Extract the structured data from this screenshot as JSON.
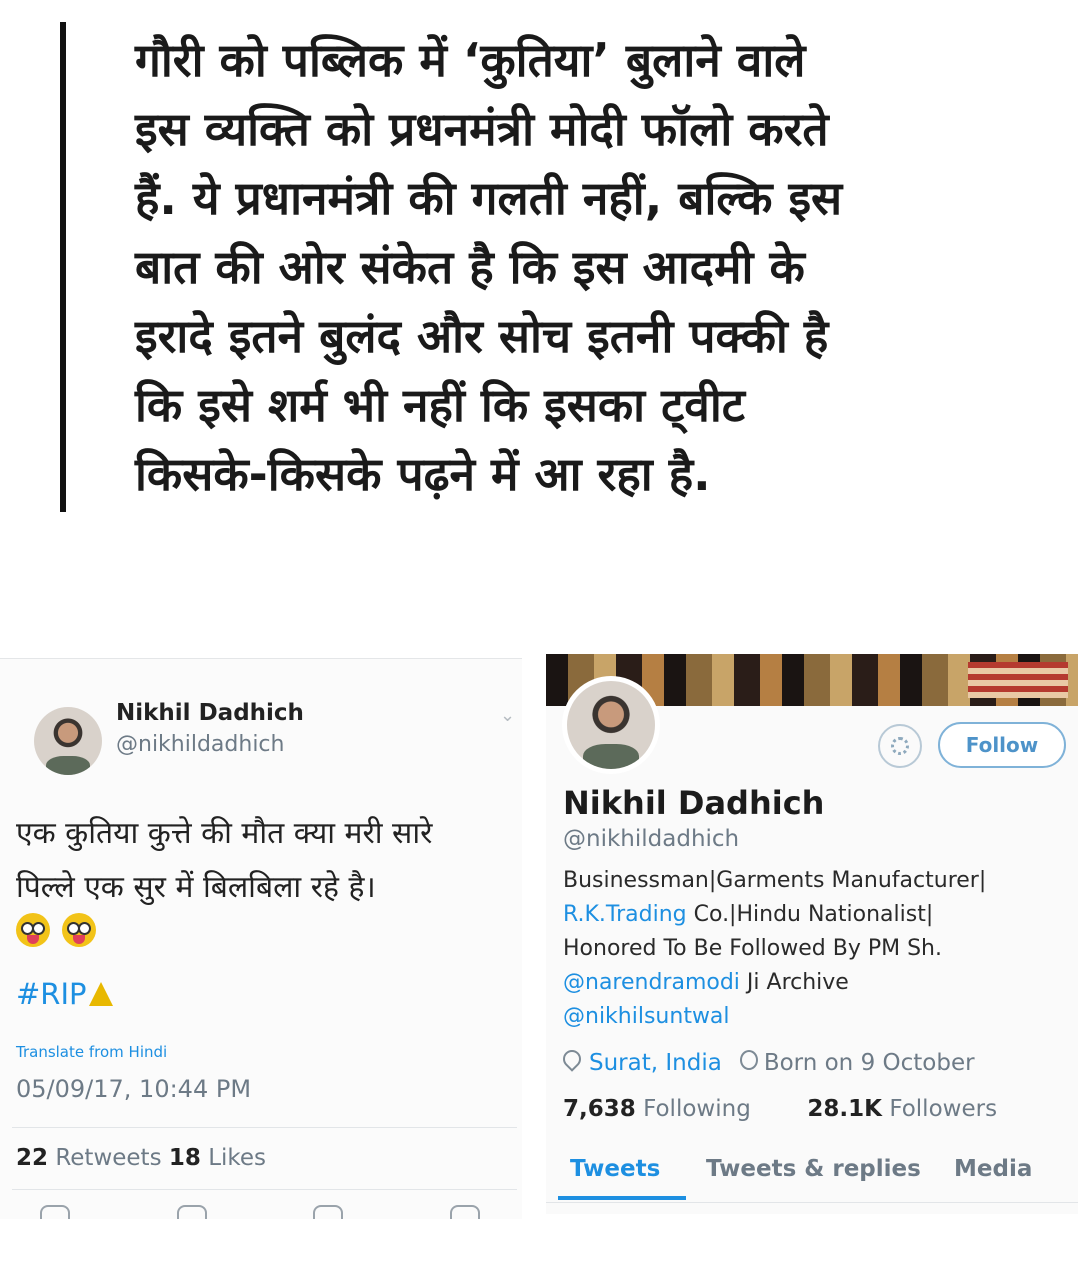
{
  "headline": {
    "lines": [
      "गौरी को पब्लिक में ‘कुतिया’ बुलाने वाले",
      "इस व्यक्ति को प्रधनमंत्री मोदी फॉलो करते",
      "हैं. ये प्रधानमंत्री की गलती नहीं, बल्कि इस",
      "बात की ओर संकेत है कि इस आदमी के",
      "इरादे इतने बुलंद और सोच इतनी पक्की है",
      "कि इसे शर्म भी नहीं कि इसका ट्वीट",
      "किसके-किसके पढ़ने में आ रहा है."
    ]
  },
  "tweet": {
    "name": "Nikhil Dadhich",
    "handle": "@nikhildadhich",
    "body_line1": "एक कुतिया कुत्ते की मौत क्या मरी सारे",
    "body_line2": "पिल्ले एक सुर में बिलबिला रहे है।",
    "hashtag": "#RIP",
    "translate": "Translate from Hindi",
    "timestamp": "05/09/17, 10:44 PM",
    "retweets_count": "22",
    "retweets_label": "Retweets",
    "likes_count": "18",
    "likes_label": "Likes"
  },
  "profile": {
    "follow_label": "Follow",
    "name": "Nikhil Dadhich",
    "handle": "@nikhildadhich",
    "bio_line1": "Businessman|Garments Manufacturer|",
    "bio_link1": "R.K.Trading",
    "bio_line2_rest": " Co.|Hindu Nationalist|",
    "bio_line3": "Honored To Be Followed By PM Sh.",
    "bio_link2": "@narendramodi",
    "bio_line4_rest": " Ji Archive",
    "bio_link3": "@nikhilsuntwal",
    "location": "Surat, India",
    "born": "Born on 9 October",
    "following_count": "7,638",
    "following_label": "Following",
    "followers_count": "28.1K",
    "followers_label": "Followers",
    "tabs": [
      "Tweets",
      "Tweets & replies",
      "Media"
    ],
    "active_tab": "Tweets"
  },
  "colors": {
    "link": "#1d8fe1",
    "muted": "#6d7a86",
    "follow_border": "#7fb2d8"
  },
  "icons": [
    "caret-down-icon",
    "emoji-tongue-icon",
    "bell-icon",
    "reply-icon",
    "retweet-icon",
    "like-icon",
    "message-icon",
    "gear-icon",
    "location-pin-icon",
    "balloon-icon"
  ]
}
